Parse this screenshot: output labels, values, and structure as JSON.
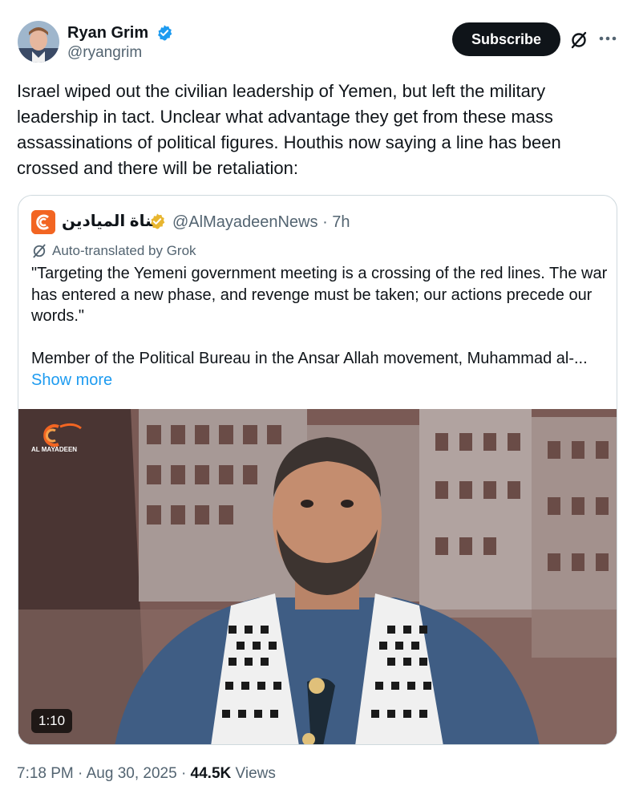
{
  "author": {
    "display_name": "Ryan Grim",
    "handle": "@ryangrim",
    "verified_icon": "verified-badge-blue"
  },
  "actions": {
    "subscribe_label": "Subscribe",
    "grok_icon": "grok-icon",
    "more_icon": "more-dots-icon"
  },
  "tweet": {
    "text": "Israel wiped out the civilian leadership of Yemen, but left the military leadership in tact. Unclear what advantage they get from these mass assassinations of political figures. Houthis now saying a line has been crossed and there will be retaliation:"
  },
  "quote": {
    "display_name": "قناة الميادين",
    "handle": "@AlMayadeenNews",
    "separator": "·",
    "time": "7h",
    "translated_label": "Auto-translated by Grok",
    "paragraph_1": "\"Targeting the Yemeni government meeting is a crossing of the red lines. The war has entered a new phase, and revenge must be taken; our actions precede our words.\"",
    "paragraph_2": "Member of the Political Bureau in the Ansar Allah movement, Muhammad al-...",
    "show_more": "Show more",
    "video": {
      "duration": "1:10",
      "channel_watermark": "AL MAYADEEN"
    }
  },
  "footer": {
    "time": "7:18 PM",
    "sep1": "·",
    "date": "Aug 30, 2025",
    "sep2": "·",
    "views_count": "44.5K",
    "views_label": "Views"
  },
  "colors": {
    "accent": "#1d9bf0",
    "text": "#0f1419",
    "secondary": "#536471",
    "border": "#cfd9de",
    "verified_gold": "#e8b630",
    "logo_orange": "#f26522"
  }
}
